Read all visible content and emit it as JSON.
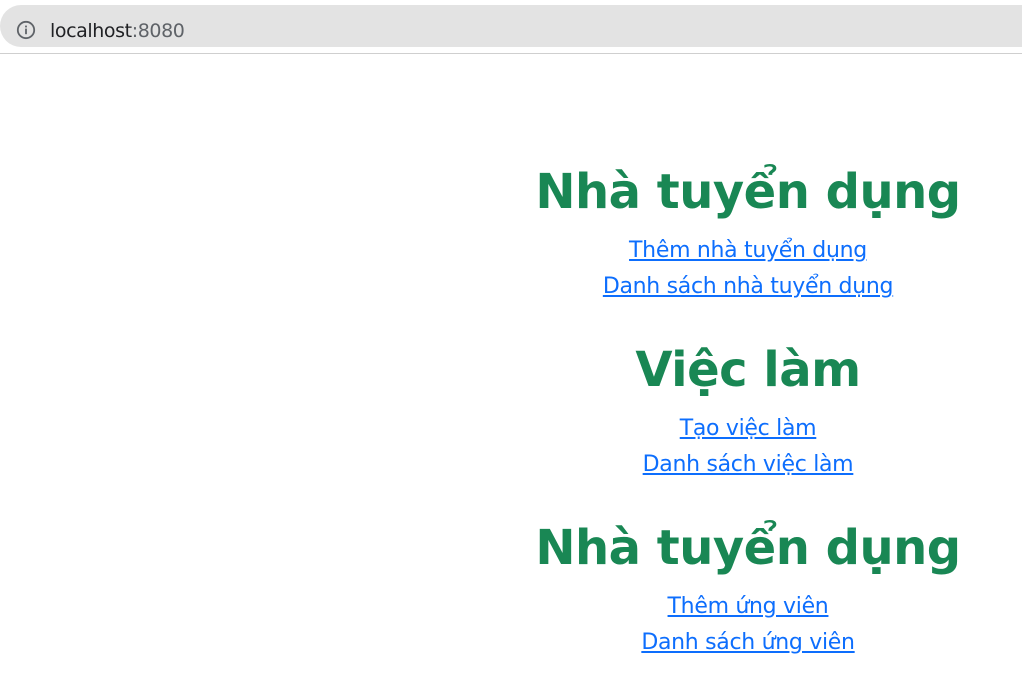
{
  "browser": {
    "url_host": "localhost",
    "url_port": ":8080",
    "info_icon": "info-icon"
  },
  "sections": [
    {
      "title": "Nhà tuyển dụng",
      "links": [
        "Thêm nhà tuyển dụng",
        "Danh sách nhà tuyển dụng"
      ]
    },
    {
      "title": "Việc làm",
      "links": [
        "Tạo việc làm",
        "Danh sách việc làm"
      ]
    },
    {
      "title": "Nhà tuyển dụng",
      "links": [
        "Thêm ứng viên",
        "Danh sách ứng viên"
      ]
    }
  ],
  "colors": {
    "heading": "#198754",
    "link": "#0d6efd",
    "omnibox": "#e3e3e3"
  }
}
